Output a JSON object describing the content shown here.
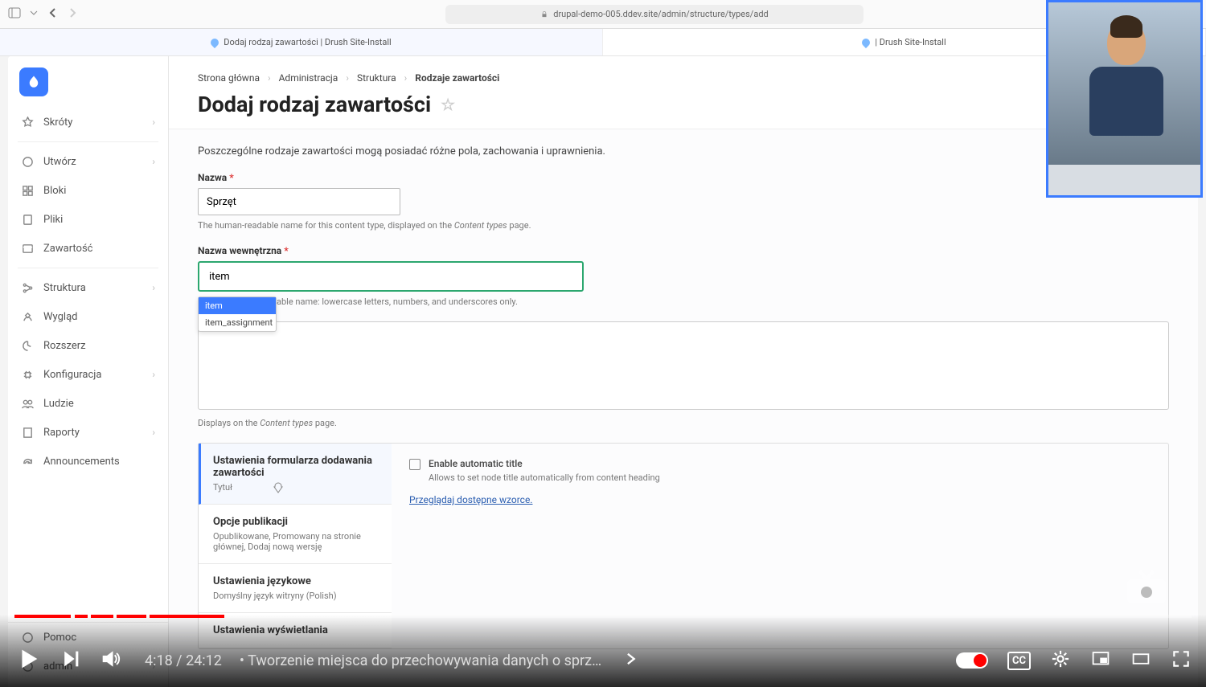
{
  "browser": {
    "url": "drupal-demo-005.ddev.site/admin/structure/types/add",
    "tab1": "Dodaj rodzaj zawartości | Drush Site-Install",
    "tab2": "| Drush Site-Install"
  },
  "sidebar": {
    "items": [
      {
        "label": "Skróty",
        "chev": true
      },
      {
        "label": "Utwórz",
        "chev": true
      },
      {
        "label": "Bloki",
        "chev": false
      },
      {
        "label": "Pliki",
        "chev": false
      },
      {
        "label": "Zawartość",
        "chev": false
      },
      {
        "label": "Struktura",
        "chev": true
      },
      {
        "label": "Wygląd",
        "chev": false
      },
      {
        "label": "Rozszerz",
        "chev": false
      },
      {
        "label": "Konfiguracja",
        "chev": true
      },
      {
        "label": "Ludzie",
        "chev": false
      },
      {
        "label": "Raporty",
        "chev": true
      },
      {
        "label": "Announcements",
        "chev": false
      }
    ],
    "bottom": [
      {
        "label": "Pomoc",
        "chev": false
      },
      {
        "label": "admin",
        "chev": true
      }
    ]
  },
  "breadcrumbs": [
    "Strona główna",
    "Administracja",
    "Struktura",
    "Rodzaje zawartości"
  ],
  "page_title": "Dodaj rodzaj zawartości",
  "intro": "Poszczególne rodzaje zawartości mogą posiadać różne pola, zachowania i uprawnienia.",
  "name_field": {
    "label": "Nazwa",
    "value": "Sprzęt",
    "hint_pre": "The human-readable name for this content type, displayed on the ",
    "hint_em": "Content types",
    "hint_post": " page."
  },
  "machine_field": {
    "label": "Nazwa wewnętrzna",
    "value": "item",
    "hint": "able name: lowercase letters, numbers, and underscores only.",
    "suggestions": [
      "item",
      "item_assignment"
    ]
  },
  "desc_hint_pre": "Displays on the ",
  "desc_hint_em": "Content types",
  "desc_hint_post": " page.",
  "vtabs": [
    {
      "title": "Ustawienia formularza dodawania zawartości",
      "sub": "Tytuł"
    },
    {
      "title": "Opcje publikacji",
      "sub": "Opublikowane, Promowany na stronie głównej, Dodaj nową wersję"
    },
    {
      "title": "Ustawienia językowe",
      "sub": "Domyślny język witryny (Polish)"
    },
    {
      "title": "Ustawienia wyświetlania",
      "sub": ""
    }
  ],
  "panel": {
    "checkbox_label": "Enable automatic title",
    "checkbox_desc": "Allows to set node title automatically from content heading",
    "link": "Przeglądaj dostępne wzorce."
  },
  "video": {
    "current": "4:18",
    "total": "24:12",
    "chapter": "Tworzenie miejsca do przechowywania danych o sprz…",
    "cc": "CC",
    "progress_segments": [
      [
        0,
        4.8
      ],
      [
        5.1,
        6.2
      ],
      [
        6.5,
        8.4
      ],
      [
        8.7,
        11.2
      ],
      [
        11.5,
        17.8
      ]
    ]
  }
}
